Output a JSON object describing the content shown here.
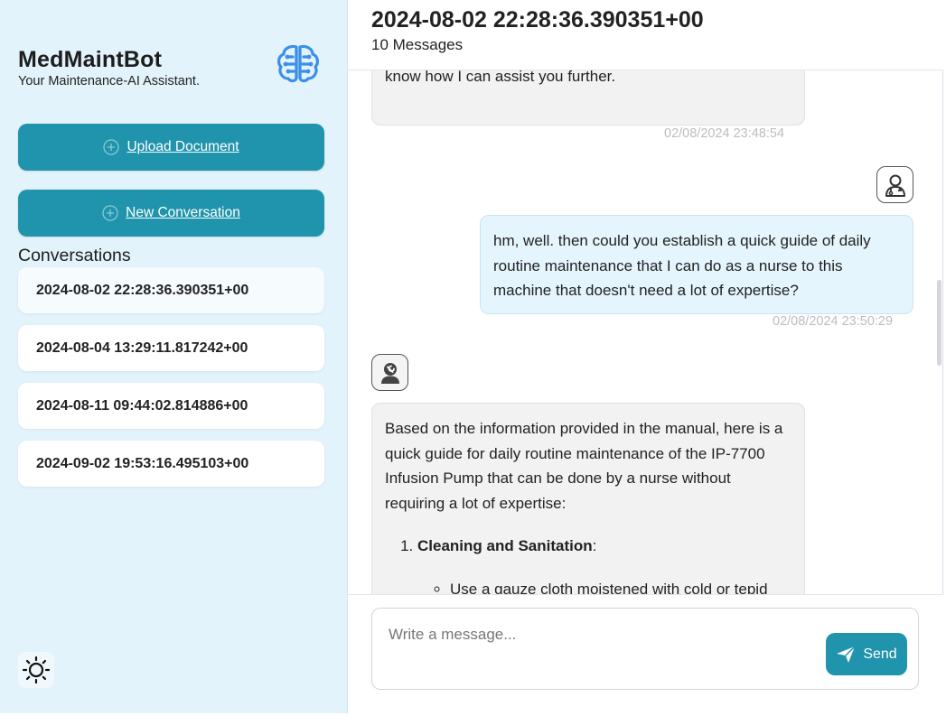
{
  "sidebar": {
    "app_title": "MedMaintBot",
    "app_subtitle": "Your Maintenance-AI Assistant.",
    "upload_label": "Upload Document",
    "new_conversation_label": "New Conversation",
    "conversations_heading": "Conversations",
    "conversations": [
      {
        "label": "2024-08-02 22:28:36.390351+00",
        "active": true
      },
      {
        "label": "2024-08-04 13:29:11.817242+00",
        "active": false
      },
      {
        "label": "2024-08-11 09:44:02.814886+00",
        "active": false
      },
      {
        "label": "2024-09-02 19:53:16.495103+00",
        "active": false
      }
    ],
    "icons": {
      "logo": "brain-circuit-icon",
      "upload": "plus-circle-icon",
      "new": "plus-circle-icon",
      "theme": "sun-icon"
    }
  },
  "chat": {
    "title": "2024-08-02 22:28:36.390351+00",
    "message_count": "10 Messages",
    "messages": [
      {
        "role": "bot",
        "text": "questions or need details from this manual, please let me know how I can assist you further.",
        "time": "02/08/2024 23:48:54"
      },
      {
        "role": "user",
        "text": "hm, well. then could you establish a quick guide of daily routine maintenance that I can do as a nurse to this machine that doesn't need a lot of expertise?",
        "time": "02/08/2024 23:50:29",
        "avatar_icon": "user-doctor-icon"
      },
      {
        "role": "bot",
        "avatar_icon": "wrench-bot-icon",
        "intro": "Based on the information provided in the manual, here is a quick guide for daily routine maintenance of the IP-7700 Infusion Pump that can be done by a nurse without requiring a lot of expertise:",
        "step_1_title": "Cleaning and Sanitation",
        "step_1_colon": ":",
        "step_1_sub_1": "Use a gauze cloth moistened with cold or tepid"
      }
    ]
  },
  "composer": {
    "placeholder": "Write a message...",
    "value": "",
    "send_label": "Send",
    "send_icon": "paper-plane-icon"
  },
  "colors": {
    "accent": "#1f94ac",
    "sidebar_bg": "#e3f3fb",
    "user_bubble": "#e5f5fd",
    "bot_bubble": "#f2f2f2"
  }
}
